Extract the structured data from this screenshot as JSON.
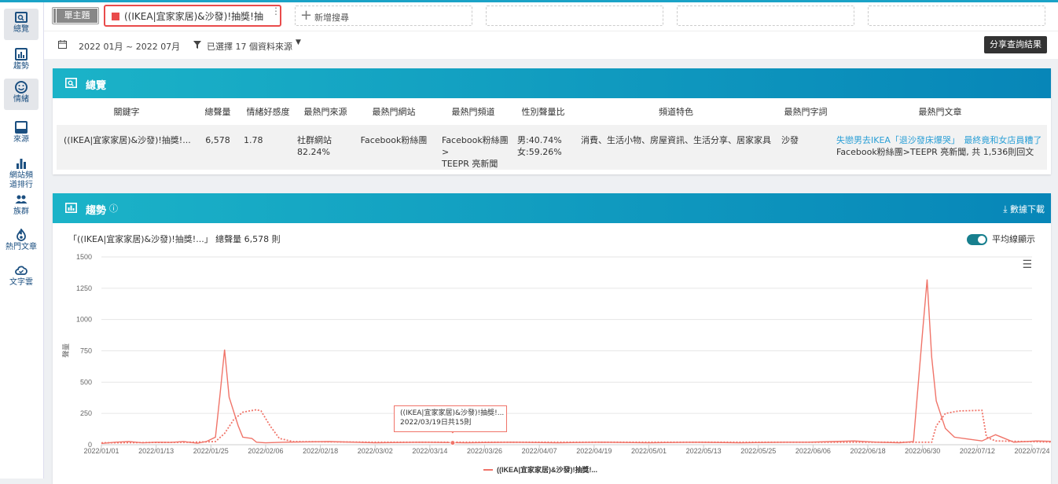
{
  "sidebar": {
    "items": [
      {
        "label": "總覽",
        "icon": "overview-icon",
        "active": true
      },
      {
        "label": "趨勢",
        "icon": "trend-icon"
      },
      {
        "label": "情緒",
        "icon": "sentiment-icon",
        "active": true
      },
      {
        "label": "來源",
        "icon": "source-icon"
      },
      {
        "label": "網站頻道排行",
        "icon": "ranking-icon"
      },
      {
        "label": "族群",
        "icon": "group-icon"
      },
      {
        "label": "熱門文章",
        "icon": "hot-article-icon"
      },
      {
        "label": "文字雲",
        "icon": "word-cloud-icon"
      }
    ]
  },
  "topbar": {
    "mode_label": "單主題",
    "query_tab": "((IKEA|宜家家居)&沙發)!抽獎!抽",
    "add_label": "新增搜尋"
  },
  "filters": {
    "date_range": "2022 01月 ~ 2022 07月",
    "sources": "已選擇 17 個資料來源",
    "share": "分享查詢結果"
  },
  "overview": {
    "title": "總覽",
    "headers": [
      "關鍵字",
      "總聲量",
      "情緒好感度",
      "最熱門來源",
      "最熱門網站",
      "最熱門頻道",
      "性別聲量比",
      "頻道特色",
      "最熱門字詞",
      "最熱門文章"
    ],
    "row": {
      "keyword": "((IKEA|宜家家居)&沙發)!抽獎!...",
      "volume": "6,578",
      "sentiment": "1.78",
      "source_line1": "社群網站",
      "source_line2": "82.24%",
      "site": "Facebook粉絲團",
      "channel_line1": "Facebook粉絲團>",
      "channel_line2": "TEEPR 亮新聞",
      "gender_male": "男:40.74%",
      "gender_female": "女:59.26%",
      "channel_feature": "消費、生活小物、房屋資訊、生活分享、居家家具",
      "top_word": "沙發",
      "article_title": "失戀男去IKEA「退沙發床爆哭」　最終竟和女店員糟了",
      "article_meta": "Facebook粉絲團>TEEPR 亮新聞, 共 1,536則回文"
    }
  },
  "trend": {
    "title": "趨勢",
    "download": "數據下載",
    "chart_title": "「((IKEA|宜家家居)&沙發)!抽獎!...」 總聲量 6,578 則",
    "avg_label": "平均線顯示",
    "tooltip_title": "((IKEA|宜家家居)&沙發)!抽獎!...",
    "tooltip_body": "2022/03/19日共15則"
  },
  "chart_data": {
    "type": "line",
    "ylabel": "聲量",
    "ylim": [
      0,
      1500
    ],
    "yticks": [
      "0",
      "250",
      "500",
      "750",
      "1000",
      "1250",
      "1500"
    ],
    "xticks": [
      "2022/01/01",
      "2022/01/13",
      "2022/01/25",
      "2022/02/06",
      "2022/02/18",
      "2022/03/02",
      "2022/03/14",
      "2022/03/26",
      "2022/04/07",
      "2022/04/19",
      "2022/05/01",
      "2022/05/13",
      "2022/05/25",
      "2022/06/06",
      "2022/06/18",
      "2022/06/30",
      "2022/07/12",
      "2022/07/24"
    ],
    "series": [
      {
        "name": "((IKEA|宜家家居)&沙發)!抽獎!...",
        "color": "#f07469",
        "style": "solid",
        "points": [
          [
            0,
            10
          ],
          [
            3,
            20
          ],
          [
            6,
            25
          ],
          [
            9,
            15
          ],
          [
            12,
            20
          ],
          [
            15,
            18
          ],
          [
            18,
            25
          ],
          [
            21,
            12
          ],
          [
            23,
            25
          ],
          [
            25,
            60
          ],
          [
            26,
            400
          ],
          [
            27,
            760
          ],
          [
            28,
            380
          ],
          [
            30,
            150
          ],
          [
            31,
            60
          ],
          [
            33,
            50
          ],
          [
            34,
            20
          ],
          [
            36,
            15
          ],
          [
            40,
            20
          ],
          [
            50,
            25
          ],
          [
            60,
            15
          ],
          [
            70,
            20
          ],
          [
            80,
            15
          ],
          [
            90,
            20
          ],
          [
            100,
            15
          ],
          [
            110,
            20
          ],
          [
            120,
            15
          ],
          [
            130,
            20
          ],
          [
            140,
            15
          ],
          [
            150,
            20
          ],
          [
            155,
            20
          ],
          [
            160,
            25
          ],
          [
            165,
            30
          ],
          [
            170,
            20
          ],
          [
            175,
            15
          ],
          [
            178,
            25
          ],
          [
            180,
            900
          ],
          [
            181,
            1320
          ],
          [
            182,
            700
          ],
          [
            183,
            350
          ],
          [
            185,
            130
          ],
          [
            187,
            60
          ],
          [
            190,
            45
          ],
          [
            193,
            30
          ],
          [
            196,
            80
          ],
          [
            200,
            20
          ],
          [
            205,
            30
          ],
          [
            215,
            20
          ],
          [
            225,
            15
          ],
          [
            235,
            20
          ],
          [
            245,
            15
          ]
        ]
      },
      {
        "name": "平均線",
        "color": "#f07469",
        "style": "dotted",
        "points": [
          [
            0,
            15
          ],
          [
            20,
            20
          ],
          [
            25,
            25
          ],
          [
            27,
            90
          ],
          [
            29,
            200
          ],
          [
            31,
            260
          ],
          [
            34,
            280
          ],
          [
            35,
            270
          ],
          [
            37,
            150
          ],
          [
            39,
            50
          ],
          [
            42,
            25
          ],
          [
            60,
            20
          ],
          [
            100,
            20
          ],
          [
            150,
            20
          ],
          [
            178,
            20
          ],
          [
            182,
            20
          ],
          [
            183,
            150
          ],
          [
            185,
            250
          ],
          [
            188,
            270
          ],
          [
            193,
            275
          ],
          [
            194,
            60
          ],
          [
            196,
            30
          ],
          [
            210,
            20
          ],
          [
            245,
            15
          ]
        ]
      }
    ]
  },
  "colors": {
    "accent": "#1aa3c7",
    "series": "#f07469",
    "nav": "#1b4f80",
    "link": "#2a9fd6"
  }
}
